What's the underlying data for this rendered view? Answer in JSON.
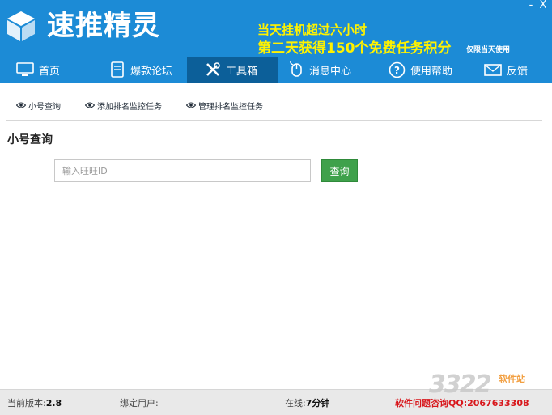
{
  "app": {
    "title": "速推精灵"
  },
  "window": {
    "minimize_symbol": "-",
    "close_symbol": "X"
  },
  "promo": {
    "line1": "当天挂机超过六小时",
    "line2": "第二天获得150个免费任务积分",
    "note": "仅限当天使用",
    "color": "#fff200"
  },
  "nav": {
    "items": [
      {
        "label": "首页",
        "icon": "monitor-icon"
      },
      {
        "label": "爆款论坛",
        "icon": "book-icon"
      },
      {
        "label": "工具箱",
        "icon": "tools-icon",
        "active": true
      },
      {
        "label": "消息中心",
        "icon": "mouse-icon"
      },
      {
        "label": "使用帮助",
        "icon": "help-icon"
      },
      {
        "label": "反馈",
        "icon": "mail-icon"
      }
    ]
  },
  "subtabs": [
    {
      "label": "小号查询",
      "icon": "eye-icon"
    },
    {
      "label": "添加排名监控任务",
      "icon": "eye-icon"
    },
    {
      "label": "管理排名监控任务",
      "icon": "eye-icon"
    }
  ],
  "section": {
    "title": "小号查询"
  },
  "search": {
    "placeholder": "输入旺旺ID",
    "value": "",
    "button_label": "查询"
  },
  "status": {
    "version_label": "当前版本:",
    "version_value": "2.8",
    "bound_user_label": "绑定用户:",
    "online_label": "在线:",
    "online_value": "7分钟",
    "contact": "软件问题咨询QQ:2067633308"
  },
  "watermark": {
    "number": "3322",
    "text": "软件站"
  },
  "colors": {
    "header_bg": "#1c8bd6",
    "nav_active": "#0c5f99",
    "button_green": "#3fa14b",
    "contact_red": "#d8171c"
  }
}
